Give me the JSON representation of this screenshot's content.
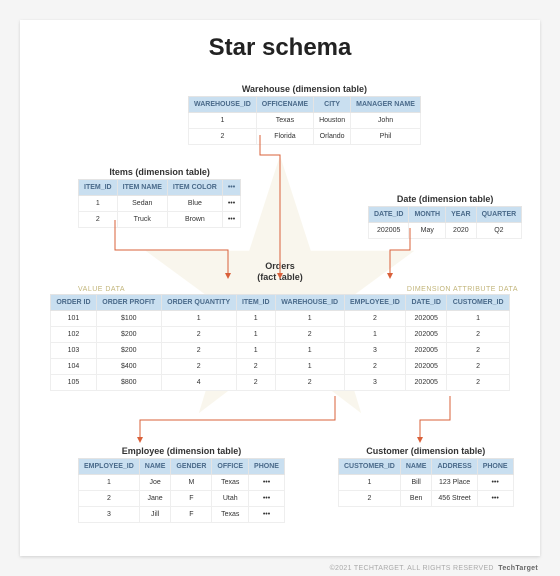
{
  "title": "Star schema",
  "footer": {
    "copyright": "©2021 TECHTARGET. ALL RIGHTS RESERVED",
    "brand": "TechTarget"
  },
  "annotations": {
    "value_data": "VALUE DATA",
    "dimension_data": "DIMENSION ATTRIBUTE DATA"
  },
  "warehouse": {
    "caption": "Warehouse (dimension table)",
    "headers": [
      "WAREHOUSE_ID",
      "OFFICENAME",
      "CITY",
      "MANAGER NAME"
    ],
    "rows": [
      [
        "1",
        "Texas",
        "Houston",
        "John"
      ],
      [
        "2",
        "Florida",
        "Orlando",
        "Phil"
      ]
    ]
  },
  "items": {
    "caption": "Items (dimension table)",
    "headers": [
      "ITEM_ID",
      "ITEM NAME",
      "ITEM COLOR",
      "•••"
    ],
    "rows": [
      [
        "1",
        "Sedan",
        "Blue",
        "•••"
      ],
      [
        "2",
        "Truck",
        "Brown",
        "•••"
      ]
    ]
  },
  "date": {
    "caption": "Date (dimension table)",
    "headers": [
      "DATE_ID",
      "MONTH",
      "YEAR",
      "QUARTER"
    ],
    "rows": [
      [
        "202005",
        "May",
        "2020",
        "Q2"
      ]
    ]
  },
  "orders": {
    "caption": "Orders\n(fact table)",
    "caption_line1": "Orders",
    "caption_line2": "(fact table)",
    "headers": [
      "ORDER ID",
      "ORDER PROFIT",
      "ORDER QUANTITY",
      "ITEM_ID",
      "WAREHOUSE_ID",
      "EMPLOYEE_ID",
      "DATE_ID",
      "CUSTOMER_ID"
    ],
    "rows": [
      [
        "101",
        "$100",
        "1",
        "1",
        "1",
        "2",
        "202005",
        "1"
      ],
      [
        "102",
        "$200",
        "2",
        "1",
        "2",
        "1",
        "202005",
        "2"
      ],
      [
        "103",
        "$200",
        "2",
        "1",
        "1",
        "3",
        "202005",
        "2"
      ],
      [
        "104",
        "$400",
        "2",
        "2",
        "1",
        "2",
        "202005",
        "2"
      ],
      [
        "105",
        "$800",
        "4",
        "2",
        "2",
        "3",
        "202005",
        "2"
      ]
    ]
  },
  "employee": {
    "caption": "Employee (dimension table)",
    "headers": [
      "EMPLOYEE_ID",
      "NAME",
      "GENDER",
      "OFFICE",
      "PHONE"
    ],
    "rows": [
      [
        "1",
        "Joe",
        "M",
        "Texas",
        "•••"
      ],
      [
        "2",
        "Jane",
        "F",
        "Utah",
        "•••"
      ],
      [
        "3",
        "Jill",
        "F",
        "Texas",
        "•••"
      ]
    ]
  },
  "customer": {
    "caption": "Customer (dimension table)",
    "headers": [
      "CUSTOMER_ID",
      "NAME",
      "ADDRESS",
      "PHONE"
    ],
    "rows": [
      [
        "1",
        "Bill",
        "123 Place",
        "•••"
      ],
      [
        "2",
        "Ben",
        "456 Street",
        "•••"
      ]
    ]
  }
}
